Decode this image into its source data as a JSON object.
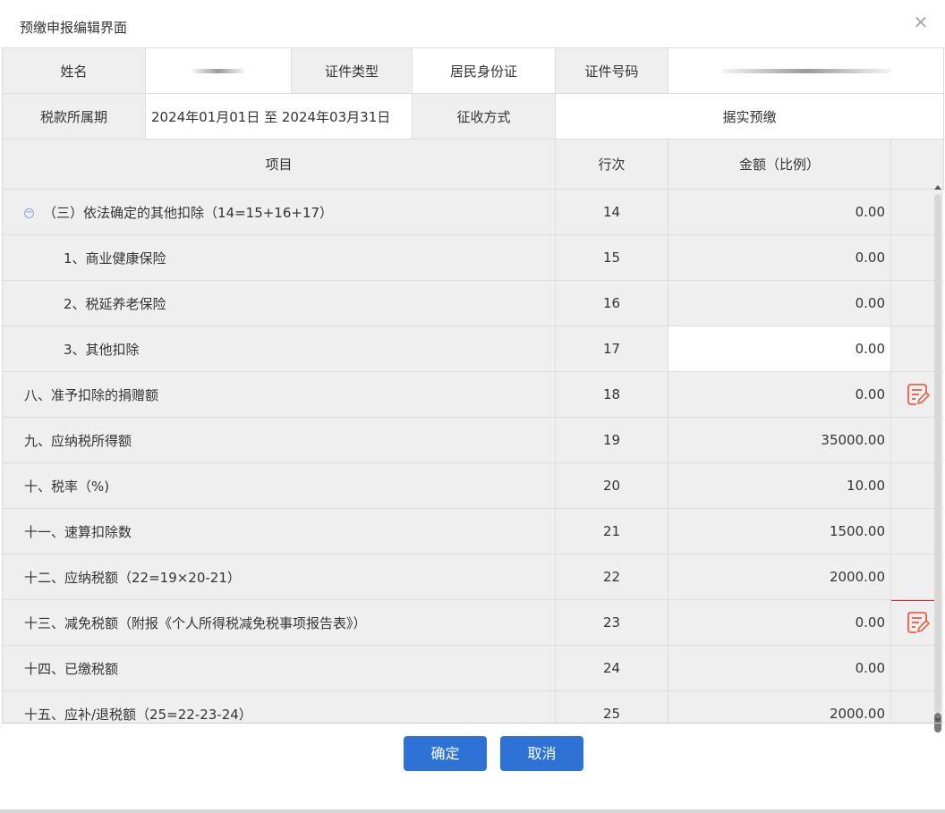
{
  "dialog": {
    "title": "预缴申报编辑界面",
    "close_glyph": "✕"
  },
  "info": {
    "name_label": "姓名",
    "id_type_label": "证件类型",
    "id_type_value": "居民身份证",
    "id_no_label": "证件号码",
    "period_label": "税款所属期",
    "period_value": "2024年01月01日 至 2024年03月31日",
    "collect_label": "征收方式",
    "collect_value": "据实预缴"
  },
  "grid": {
    "headers": {
      "item": "项目",
      "line": "行次",
      "amount": "金额（比例）"
    },
    "rows": [
      {
        "item": "（三）依法确定的其他扣除（14=15+16+17）",
        "line": "14",
        "amount": "0.00"
      },
      {
        "item": "1、商业健康保险",
        "line": "15",
        "amount": "0.00"
      },
      {
        "item": "2、税延养老保险",
        "line": "16",
        "amount": "0.00"
      },
      {
        "item": "3、其他扣除",
        "line": "17",
        "amount": "0.00"
      },
      {
        "item": "八、准予扣除的捐赠额",
        "line": "18",
        "amount": "0.00"
      },
      {
        "item": "九、应纳税所得额",
        "line": "19",
        "amount": "35000.00"
      },
      {
        "item": "十、税率（%)",
        "line": "20",
        "amount": "10.00"
      },
      {
        "item": "十一、速算扣除数",
        "line": "21",
        "amount": "1500.00"
      },
      {
        "item": "十二、应纳税额（22=19×20-21）",
        "line": "22",
        "amount": "2000.00"
      },
      {
        "item": "十三、减免税额（附报《个人所得税减免税事项报告表》）",
        "line": "23",
        "amount": "0.00"
      },
      {
        "item": "十四、已缴税额",
        "line": "24",
        "amount": "0.00"
      },
      {
        "item": "十五、应补/退税额（25=22-23-24）",
        "line": "25",
        "amount": "2000.00"
      }
    ]
  },
  "footer": {
    "ok_label": "确定",
    "cancel_label": "取消"
  },
  "colors": {
    "primary": "#2f72d6",
    "highlight": "#e02020",
    "edit_icon": "#e8604c",
    "label_bg": "#efefef"
  }
}
